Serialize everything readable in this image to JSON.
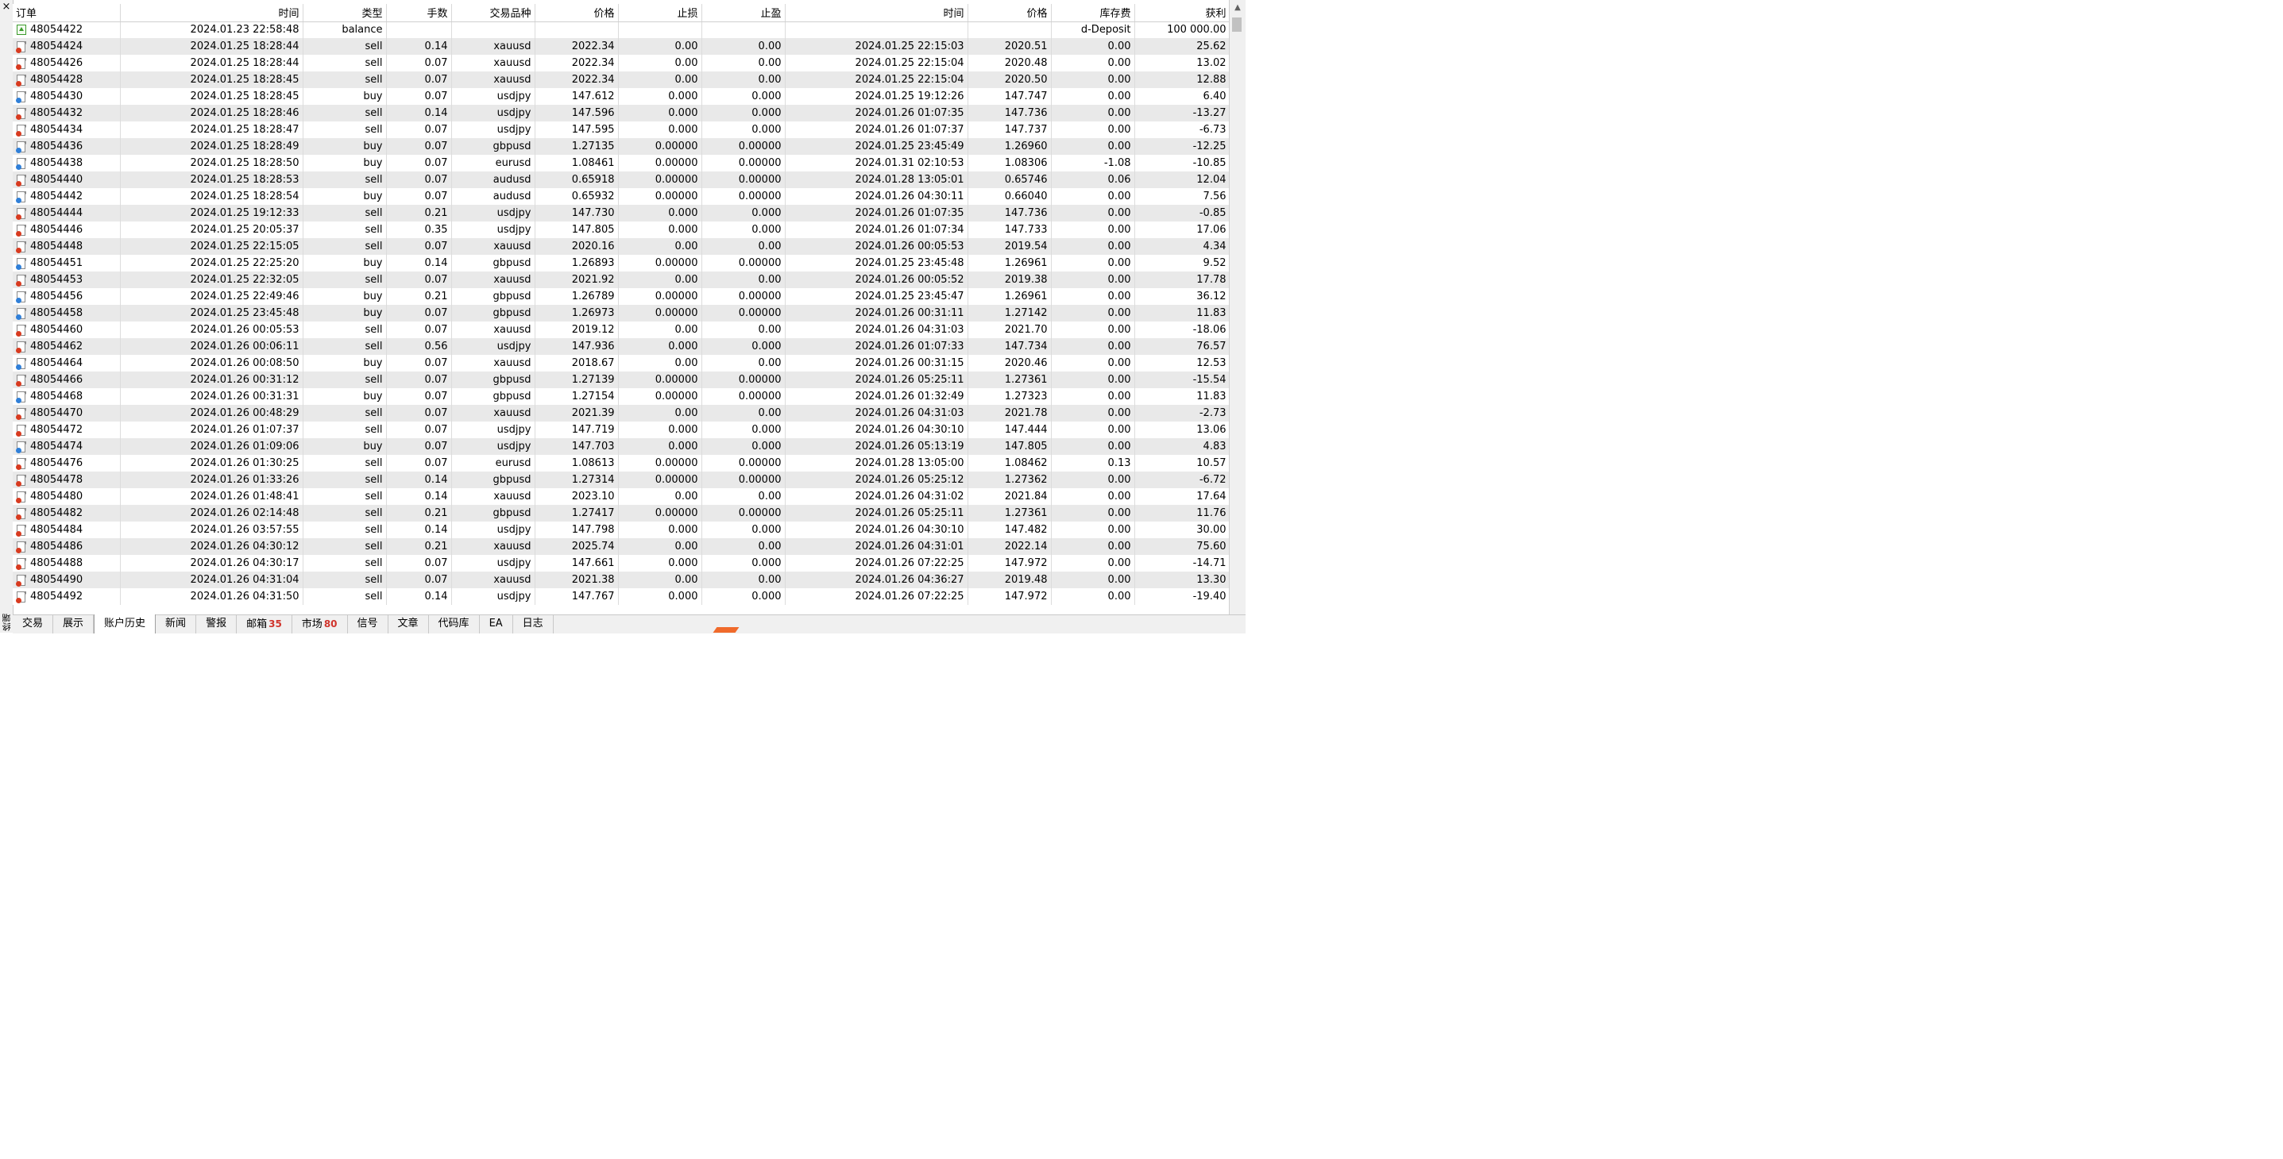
{
  "window": {
    "close_glyph": "×",
    "vertical_label": "终端"
  },
  "table": {
    "headers": [
      "订单",
      "时间",
      "类型",
      "手数",
      "交易品种",
      "价格",
      "止损",
      "止盈",
      "时间",
      "价格",
      "库存费",
      "获利"
    ],
    "balance_row": {
      "ticket": "48054422",
      "open_time": "2024.01.23 22:58:48",
      "type": "balance",
      "comment": "d-Deposit",
      "profit": "100 000.00"
    },
    "rows": [
      [
        "48054424",
        "2024.01.25 18:28:44",
        "sell",
        "0.14",
        "xauusd",
        "2022.34",
        "0.00",
        "0.00",
        "2024.01.25 22:15:03",
        "2020.51",
        "0.00",
        "25.62"
      ],
      [
        "48054426",
        "2024.01.25 18:28:44",
        "sell",
        "0.07",
        "xauusd",
        "2022.34",
        "0.00",
        "0.00",
        "2024.01.25 22:15:04",
        "2020.48",
        "0.00",
        "13.02"
      ],
      [
        "48054428",
        "2024.01.25 18:28:45",
        "sell",
        "0.07",
        "xauusd",
        "2022.34",
        "0.00",
        "0.00",
        "2024.01.25 22:15:04",
        "2020.50",
        "0.00",
        "12.88"
      ],
      [
        "48054430",
        "2024.01.25 18:28:45",
        "buy",
        "0.07",
        "usdjpy",
        "147.612",
        "0.000",
        "0.000",
        "2024.01.25 19:12:26",
        "147.747",
        "0.00",
        "6.40"
      ],
      [
        "48054432",
        "2024.01.25 18:28:46",
        "sell",
        "0.14",
        "usdjpy",
        "147.596",
        "0.000",
        "0.000",
        "2024.01.26 01:07:35",
        "147.736",
        "0.00",
        "-13.27"
      ],
      [
        "48054434",
        "2024.01.25 18:28:47",
        "sell",
        "0.07",
        "usdjpy",
        "147.595",
        "0.000",
        "0.000",
        "2024.01.26 01:07:37",
        "147.737",
        "0.00",
        "-6.73"
      ],
      [
        "48054436",
        "2024.01.25 18:28:49",
        "buy",
        "0.07",
        "gbpusd",
        "1.27135",
        "0.00000",
        "0.00000",
        "2024.01.25 23:45:49",
        "1.26960",
        "0.00",
        "-12.25"
      ],
      [
        "48054438",
        "2024.01.25 18:28:50",
        "buy",
        "0.07",
        "eurusd",
        "1.08461",
        "0.00000",
        "0.00000",
        "2024.01.31 02:10:53",
        "1.08306",
        "-1.08",
        "-10.85"
      ],
      [
        "48054440",
        "2024.01.25 18:28:53",
        "sell",
        "0.07",
        "audusd",
        "0.65918",
        "0.00000",
        "0.00000",
        "2024.01.28 13:05:01",
        "0.65746",
        "0.06",
        "12.04"
      ],
      [
        "48054442",
        "2024.01.25 18:28:54",
        "buy",
        "0.07",
        "audusd",
        "0.65932",
        "0.00000",
        "0.00000",
        "2024.01.26 04:30:11",
        "0.66040",
        "0.00",
        "7.56"
      ],
      [
        "48054444",
        "2024.01.25 19:12:33",
        "sell",
        "0.21",
        "usdjpy",
        "147.730",
        "0.000",
        "0.000",
        "2024.01.26 01:07:35",
        "147.736",
        "0.00",
        "-0.85"
      ],
      [
        "48054446",
        "2024.01.25 20:05:37",
        "sell",
        "0.35",
        "usdjpy",
        "147.805",
        "0.000",
        "0.000",
        "2024.01.26 01:07:34",
        "147.733",
        "0.00",
        "17.06"
      ],
      [
        "48054448",
        "2024.01.25 22:15:05",
        "sell",
        "0.07",
        "xauusd",
        "2020.16",
        "0.00",
        "0.00",
        "2024.01.26 00:05:53",
        "2019.54",
        "0.00",
        "4.34"
      ],
      [
        "48054451",
        "2024.01.25 22:25:20",
        "buy",
        "0.14",
        "gbpusd",
        "1.26893",
        "0.00000",
        "0.00000",
        "2024.01.25 23:45:48",
        "1.26961",
        "0.00",
        "9.52"
      ],
      [
        "48054453",
        "2024.01.25 22:32:05",
        "sell",
        "0.07",
        "xauusd",
        "2021.92",
        "0.00",
        "0.00",
        "2024.01.26 00:05:52",
        "2019.38",
        "0.00",
        "17.78"
      ],
      [
        "48054456",
        "2024.01.25 22:49:46",
        "buy",
        "0.21",
        "gbpusd",
        "1.26789",
        "0.00000",
        "0.00000",
        "2024.01.25 23:45:47",
        "1.26961",
        "0.00",
        "36.12"
      ],
      [
        "48054458",
        "2024.01.25 23:45:48",
        "buy",
        "0.07",
        "gbpusd",
        "1.26973",
        "0.00000",
        "0.00000",
        "2024.01.26 00:31:11",
        "1.27142",
        "0.00",
        "11.83"
      ],
      [
        "48054460",
        "2024.01.26 00:05:53",
        "sell",
        "0.07",
        "xauusd",
        "2019.12",
        "0.00",
        "0.00",
        "2024.01.26 04:31:03",
        "2021.70",
        "0.00",
        "-18.06"
      ],
      [
        "48054462",
        "2024.01.26 00:06:11",
        "sell",
        "0.56",
        "usdjpy",
        "147.936",
        "0.000",
        "0.000",
        "2024.01.26 01:07:33",
        "147.734",
        "0.00",
        "76.57"
      ],
      [
        "48054464",
        "2024.01.26 00:08:50",
        "buy",
        "0.07",
        "xauusd",
        "2018.67",
        "0.00",
        "0.00",
        "2024.01.26 00:31:15",
        "2020.46",
        "0.00",
        "12.53"
      ],
      [
        "48054466",
        "2024.01.26 00:31:12",
        "sell",
        "0.07",
        "gbpusd",
        "1.27139",
        "0.00000",
        "0.00000",
        "2024.01.26 05:25:11",
        "1.27361",
        "0.00",
        "-15.54"
      ],
      [
        "48054468",
        "2024.01.26 00:31:31",
        "buy",
        "0.07",
        "gbpusd",
        "1.27154",
        "0.00000",
        "0.00000",
        "2024.01.26 01:32:49",
        "1.27323",
        "0.00",
        "11.83"
      ],
      [
        "48054470",
        "2024.01.26 00:48:29",
        "sell",
        "0.07",
        "xauusd",
        "2021.39",
        "0.00",
        "0.00",
        "2024.01.26 04:31:03",
        "2021.78",
        "0.00",
        "-2.73"
      ],
      [
        "48054472",
        "2024.01.26 01:07:37",
        "sell",
        "0.07",
        "usdjpy",
        "147.719",
        "0.000",
        "0.000",
        "2024.01.26 04:30:10",
        "147.444",
        "0.00",
        "13.06"
      ],
      [
        "48054474",
        "2024.01.26 01:09:06",
        "buy",
        "0.07",
        "usdjpy",
        "147.703",
        "0.000",
        "0.000",
        "2024.01.26 05:13:19",
        "147.805",
        "0.00",
        "4.83"
      ],
      [
        "48054476",
        "2024.01.26 01:30:25",
        "sell",
        "0.07",
        "eurusd",
        "1.08613",
        "0.00000",
        "0.00000",
        "2024.01.28 13:05:00",
        "1.08462",
        "0.13",
        "10.57"
      ],
      [
        "48054478",
        "2024.01.26 01:33:26",
        "sell",
        "0.14",
        "gbpusd",
        "1.27314",
        "0.00000",
        "0.00000",
        "2024.01.26 05:25:12",
        "1.27362",
        "0.00",
        "-6.72"
      ],
      [
        "48054480",
        "2024.01.26 01:48:41",
        "sell",
        "0.14",
        "xauusd",
        "2023.10",
        "0.00",
        "0.00",
        "2024.01.26 04:31:02",
        "2021.84",
        "0.00",
        "17.64"
      ],
      [
        "48054482",
        "2024.01.26 02:14:48",
        "sell",
        "0.21",
        "gbpusd",
        "1.27417",
        "0.00000",
        "0.00000",
        "2024.01.26 05:25:11",
        "1.27361",
        "0.00",
        "11.76"
      ],
      [
        "48054484",
        "2024.01.26 03:57:55",
        "sell",
        "0.14",
        "usdjpy",
        "147.798",
        "0.000",
        "0.000",
        "2024.01.26 04:30:10",
        "147.482",
        "0.00",
        "30.00"
      ],
      [
        "48054486",
        "2024.01.26 04:30:12",
        "sell",
        "0.21",
        "xauusd",
        "2025.74",
        "0.00",
        "0.00",
        "2024.01.26 04:31:01",
        "2022.14",
        "0.00",
        "75.60"
      ],
      [
        "48054488",
        "2024.01.26 04:30:17",
        "sell",
        "0.07",
        "usdjpy",
        "147.661",
        "0.000",
        "0.000",
        "2024.01.26 07:22:25",
        "147.972",
        "0.00",
        "-14.71"
      ],
      [
        "48054490",
        "2024.01.26 04:31:04",
        "sell",
        "0.07",
        "xauusd",
        "2021.38",
        "0.00",
        "0.00",
        "2024.01.26 04:36:27",
        "2019.48",
        "0.00",
        "13.30"
      ],
      [
        "48054492",
        "2024.01.26 04:31:50",
        "sell",
        "0.14",
        "usdjpy",
        "147.767",
        "0.000",
        "0.000",
        "2024.01.26 07:22:25",
        "147.972",
        "0.00",
        "-19.40"
      ]
    ]
  },
  "tabs": [
    {
      "label": "交易",
      "badge": ""
    },
    {
      "label": "展示",
      "badge": ""
    },
    {
      "label": "账户历史",
      "badge": "",
      "active": true
    },
    {
      "label": "新闻",
      "badge": ""
    },
    {
      "label": "警报",
      "badge": ""
    },
    {
      "label": "邮箱",
      "badge": "35"
    },
    {
      "label": "市场",
      "badge": "80"
    },
    {
      "label": "信号",
      "badge": ""
    },
    {
      "label": "文章",
      "badge": ""
    },
    {
      "label": "代码库",
      "badge": ""
    },
    {
      "label": "EA",
      "badge": ""
    },
    {
      "label": "日志",
      "badge": ""
    }
  ],
  "colors": {
    "sell_icon": "#d83a1f",
    "buy_icon": "#2f7fd8",
    "balance_icon": "#3a9a2a",
    "badge": "#d0342c",
    "row_alt": "#e9e9e9"
  }
}
